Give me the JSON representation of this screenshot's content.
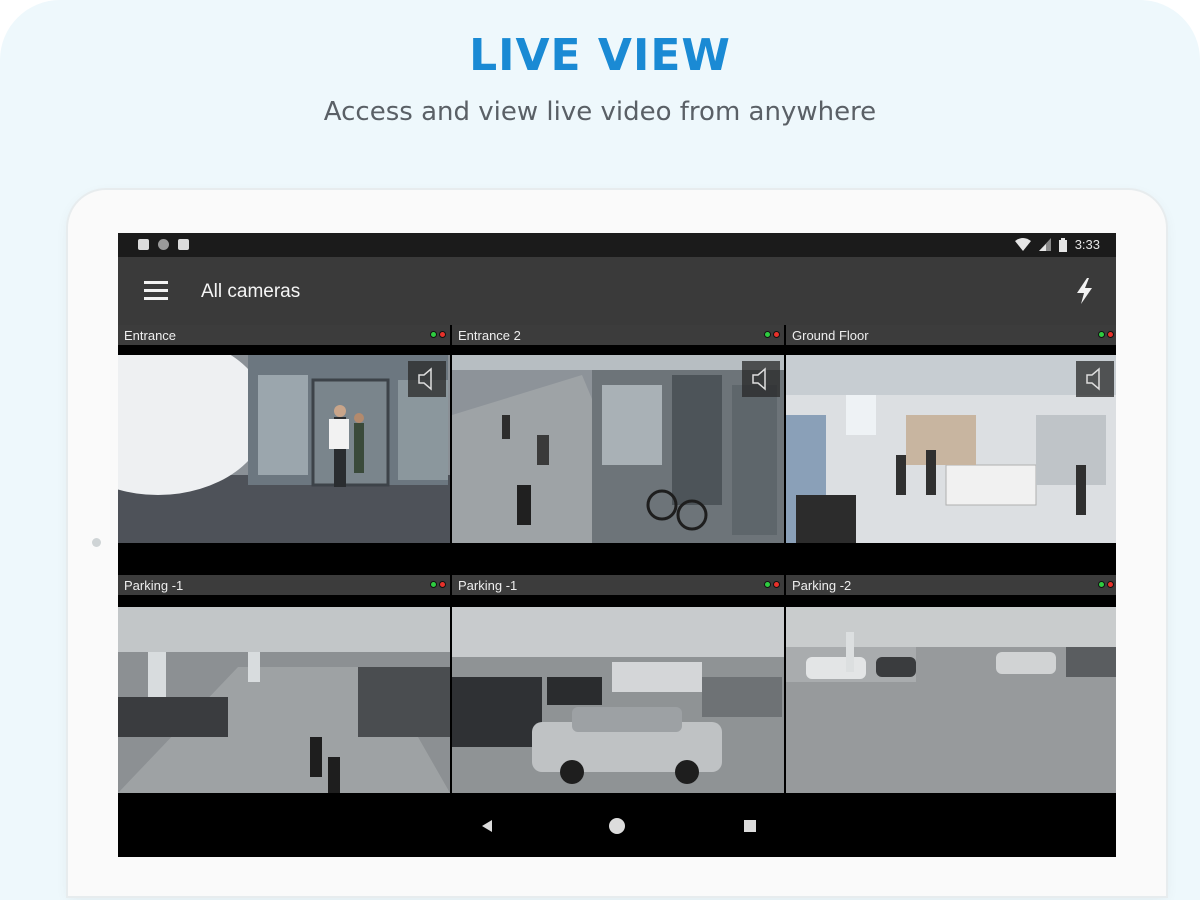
{
  "promo": {
    "headline": "LIVE VIEW",
    "subline": "Access and view live video from anywhere"
  },
  "statusbar": {
    "time": "3:33",
    "left_icons": [
      "notification-a-icon",
      "circle-icon",
      "sd-card-icon"
    ],
    "right_icons": [
      "wifi-icon",
      "signal-icon",
      "battery-icon"
    ]
  },
  "appbar": {
    "title": "All cameras",
    "menu_icon": "hamburger-menu-icon",
    "action_icon": "flash-icon"
  },
  "cameras": [
    {
      "name": "Entrance",
      "status_colors": [
        "#2ecc40",
        "#e8312a"
      ],
      "scene": "entrance"
    },
    {
      "name": "Entrance 2",
      "status_colors": [
        "#2ecc40",
        "#e8312a"
      ],
      "scene": "street"
    },
    {
      "name": "Ground Floor",
      "status_colors": [
        "#2ecc40",
        "#e8312a"
      ],
      "scene": "store"
    },
    {
      "name": "Parking -1",
      "status_colors": [
        "#2ecc40",
        "#e8312a"
      ],
      "scene": "parking"
    },
    {
      "name": "Parking -1",
      "status_colors": [
        "#2ecc40",
        "#e8312a"
      ],
      "scene": "parking"
    },
    {
      "name": "Parking -2",
      "status_colors": [
        "#2ecc40",
        "#e8312a"
      ],
      "scene": "parking"
    }
  ],
  "navbar": {
    "icons": [
      "back-icon",
      "home-icon",
      "recents-icon"
    ]
  },
  "colors": {
    "accent": "#1a8ad4",
    "appbar": "#3a3a3a",
    "background": "#eef8fc"
  }
}
